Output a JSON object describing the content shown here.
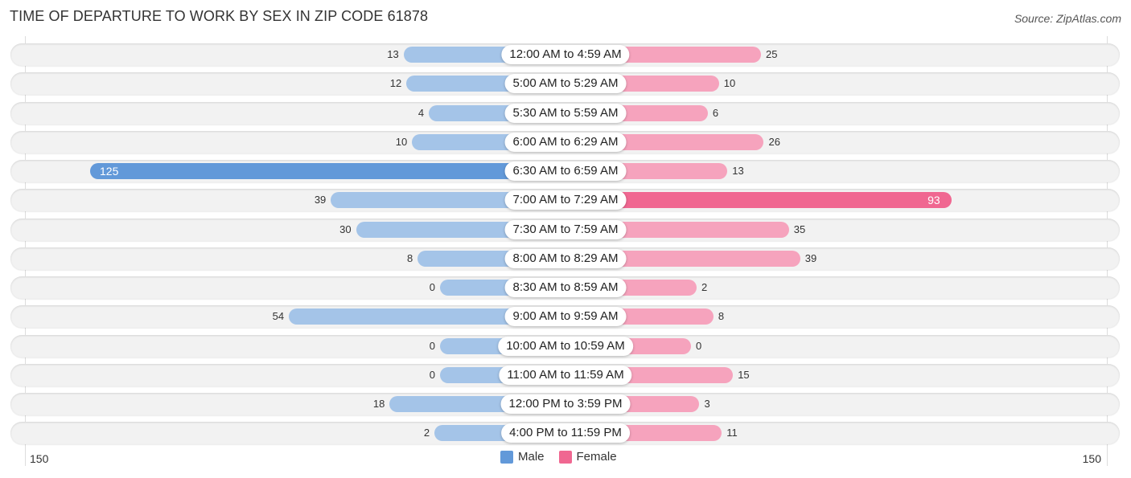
{
  "chart_data": {
    "type": "bar",
    "orientation": "horizontal-diverging",
    "title": "TIME OF DEPARTURE TO WORK BY SEX IN ZIP CODE 61878",
    "source": "Source: ZipAtlas.com",
    "categories": [
      "12:00 AM to 4:59 AM",
      "5:00 AM to 5:29 AM",
      "5:30 AM to 5:59 AM",
      "6:00 AM to 6:29 AM",
      "6:30 AM to 6:59 AM",
      "7:00 AM to 7:29 AM",
      "7:30 AM to 7:59 AM",
      "8:00 AM to 8:29 AM",
      "8:30 AM to 8:59 AM",
      "9:00 AM to 9:59 AM",
      "10:00 AM to 10:59 AM",
      "11:00 AM to 11:59 AM",
      "12:00 PM to 3:59 PM",
      "4:00 PM to 11:59 PM"
    ],
    "series": [
      {
        "name": "Male",
        "color": "#6299d9",
        "light_color": "#a4c4e8",
        "values": [
          13,
          12,
          4,
          10,
          125,
          39,
          30,
          8,
          0,
          54,
          0,
          0,
          18,
          2
        ]
      },
      {
        "name": "Female",
        "color": "#f06791",
        "light_color": "#f6a3bd",
        "values": [
          25,
          10,
          6,
          26,
          13,
          93,
          35,
          39,
          2,
          8,
          0,
          15,
          3,
          11
        ]
      }
    ],
    "axis": {
      "left_label": "150",
      "right_label": "150",
      "range": [
        150,
        150
      ]
    },
    "legend": {
      "placement": "bottom-center",
      "entries": [
        "Male",
        "Female"
      ]
    },
    "grid": false
  }
}
